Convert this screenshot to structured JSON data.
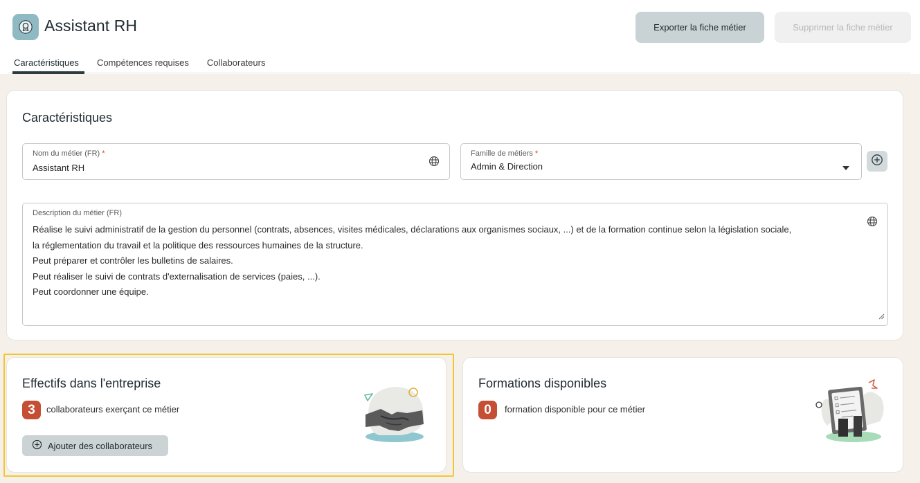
{
  "header": {
    "title": "Assistant RH",
    "export_label": "Exporter la fiche métier",
    "delete_label": "Supprimer la fiche métier"
  },
  "tabs": [
    {
      "label": "Caractéristiques",
      "active": true
    },
    {
      "label": "Compétences requises",
      "active": false
    },
    {
      "label": "Collaborateurs",
      "active": false
    }
  ],
  "characteristics": {
    "title": "Caractéristiques",
    "job_name": {
      "label": "Nom du métier (FR)",
      "required_mark": "*",
      "value": "Assistant RH"
    },
    "job_family": {
      "label": "Famille de métiers",
      "required_mark": "*",
      "value": "Admin & Direction"
    },
    "description": {
      "label": "Description du métier (FR)",
      "lines": [
        "Réalise le suivi administratif de la gestion du personnel (contrats, absences, visites médicales, déclarations aux organismes sociaux, ...) et de la formation continue selon la législation sociale,",
        "la réglementation du travail et la politique des ressources humaines de la structure.",
        "Peut préparer et contrôler les bulletins de salaires.",
        "Peut réaliser le suivi de contrats d'externalisation de services (paies, ...).",
        "Peut coordonner une équipe."
      ]
    }
  },
  "headcount": {
    "title": "Effectifs dans l'entreprise",
    "count": "3",
    "text": "collaborateurs exerçant ce métier",
    "add_label": "Ajouter des collaborateurs"
  },
  "trainings": {
    "title": "Formations disponibles",
    "count": "0",
    "text": "formation disponible pour ce métier"
  },
  "colors": {
    "accent": "#c44f35",
    "primary_button": "#c9d2d4",
    "highlight": "#f5c531",
    "logo_bg": "#8fbac3"
  },
  "icons": {
    "logo": "award-badge-icon",
    "globe": "globe-icon",
    "dropdown": "caret-down-icon",
    "add": "plus-circle-icon"
  }
}
